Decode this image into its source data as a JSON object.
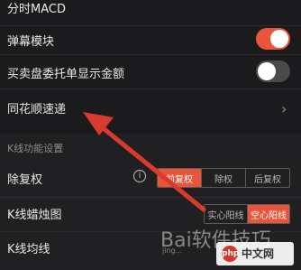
{
  "settings": {
    "rows": [
      {
        "label": "分时MACD"
      },
      {
        "label": "弹幕模块"
      },
      {
        "label": "买卖盘委托单显示金额"
      },
      {
        "label": "同花顺速递"
      }
    ]
  },
  "kline": {
    "section_title": "K线功能设置",
    "rows": [
      {
        "label": "除复权"
      },
      {
        "label": "K线蜡烛图"
      },
      {
        "label": "K线均线"
      }
    ],
    "fuquan_options": [
      "前复权",
      "除权",
      "后复权"
    ],
    "candle_options": [
      "实心阳线",
      "空心阳线"
    ]
  },
  "icons": {
    "gear": "gear-icon",
    "chevron": "chevron-right-icon",
    "info": "info-icon",
    "arrow": "red-arrow-annotation"
  },
  "colors": {
    "accent": "#e9553a",
    "background": "#1b1b1d",
    "arrow": "#d93a2f"
  },
  "toggles": {
    "danmu_on": true,
    "amount_on": false
  },
  "watermark": {
    "main": "Bai软件技巧",
    "sub": "jing...",
    "logo_text": "中文网",
    "logo_icon": "php"
  }
}
